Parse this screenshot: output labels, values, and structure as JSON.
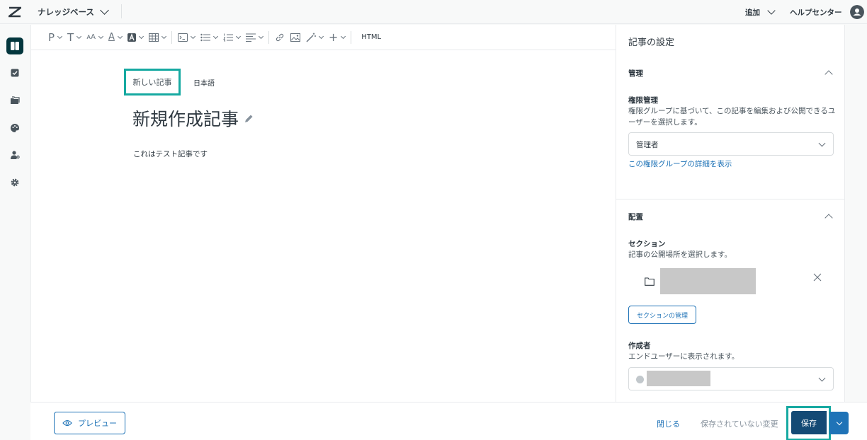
{
  "topbar": {
    "product_name": "ナレッジベース",
    "add_label": "追加",
    "help_center_label": "ヘルプセンター"
  },
  "rail": {
    "items": [
      {
        "icon": "book-icon",
        "active": true
      },
      {
        "icon": "checklist-icon",
        "active": false
      },
      {
        "icon": "folders-icon",
        "active": false
      },
      {
        "icon": "palette-icon",
        "active": false
      },
      {
        "icon": "user-permissions-icon",
        "active": false
      },
      {
        "icon": "gear-icon",
        "active": false
      }
    ]
  },
  "toolbar": {
    "items": [
      "paragraph-icon",
      "text-format-icon",
      "font-size-icon",
      "text-color-icon",
      "highlight-icon",
      "table-icon",
      "code-block-icon",
      "bullet-list-icon",
      "numbered-list-icon",
      "align-icon",
      "link-icon",
      "image-icon",
      "magic-wand-icon",
      "insert-plus-icon"
    ],
    "html_label": "HTML"
  },
  "editor": {
    "tab_new_article": "新しい記事",
    "tab_language": "日本語",
    "title": "新規作成記事",
    "body": "これはテスト記事です"
  },
  "panel": {
    "title": "記事の設定",
    "management": {
      "heading": "管理",
      "permission_label": "権限管理",
      "permission_hint": "権限グループに基づいて、この記事を編集および公開できるユーザーを選択します。",
      "permission_value": "管理者",
      "permission_link": "この権限グループの詳細を表示"
    },
    "placement": {
      "heading": "配置",
      "section_label": "セクション",
      "section_hint": "記事の公開場所を選択します。",
      "manage_sections_button": "セクションの管理",
      "author_label": "作成者",
      "author_hint": "エンドユーザーに表示されます。"
    }
  },
  "footer": {
    "preview_label": "プレビュー",
    "close_label": "閉じる",
    "unsaved_label": "保存されていない変更",
    "save_label": "保存"
  },
  "colors": {
    "accent": "#1f73b7",
    "save_button": "#144a75",
    "highlight": "#16a9a1",
    "nav_active": "#03363d"
  }
}
